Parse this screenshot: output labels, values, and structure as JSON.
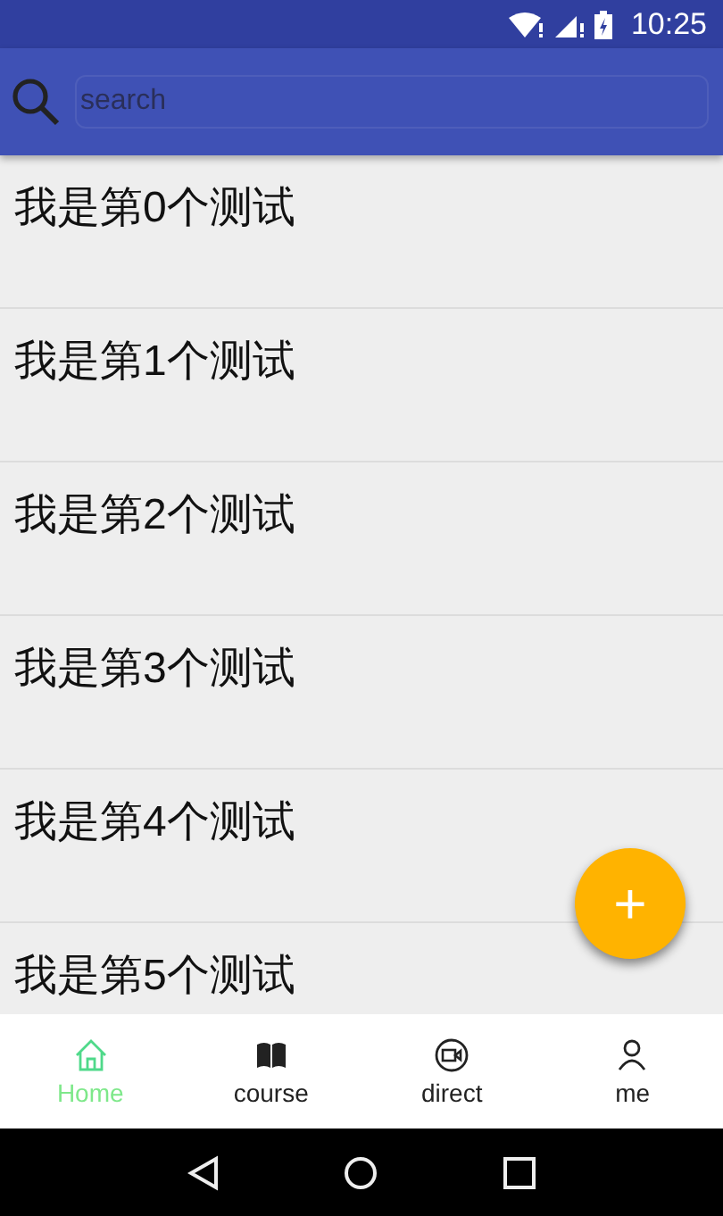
{
  "status_bar": {
    "time": "10:25"
  },
  "search": {
    "placeholder": "search"
  },
  "list": [
    {
      "label": "我是第0个测试"
    },
    {
      "label": "我是第1个测试"
    },
    {
      "label": "我是第2个测试"
    },
    {
      "label": "我是第3个测试"
    },
    {
      "label": "我是第4个测试"
    },
    {
      "label": "我是第5个测试"
    }
  ],
  "fab": {
    "symbol": "+"
  },
  "bottom_nav": [
    {
      "kind": "home",
      "label": "Home",
      "selected": true
    },
    {
      "kind": "book",
      "label": "course",
      "selected": false
    },
    {
      "kind": "video",
      "label": "direct",
      "selected": false
    },
    {
      "kind": "person",
      "label": "me",
      "selected": false
    }
  ]
}
